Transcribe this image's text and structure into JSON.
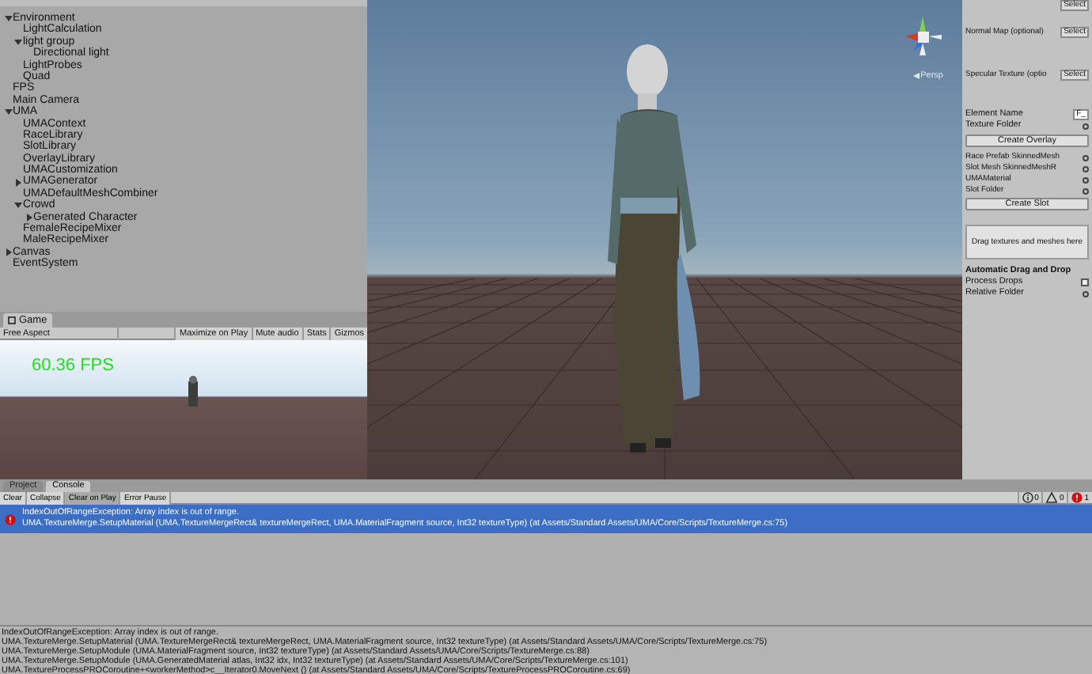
{
  "hierarchy": {
    "items": [
      {
        "label": "Environment",
        "expanded": true,
        "children": [
          {
            "label": "LightCalculation"
          },
          {
            "label": "light group",
            "expanded": true,
            "children": [
              {
                "label": "Directional light"
              }
            ]
          },
          {
            "label": "LightProbes"
          },
          {
            "label": "Quad"
          }
        ]
      },
      {
        "label": "FPS"
      },
      {
        "label": "Main Camera"
      },
      {
        "label": "UMA",
        "expanded": true,
        "children": [
          {
            "label": "UMAContext"
          },
          {
            "label": "RaceLibrary"
          },
          {
            "label": "SlotLibrary"
          },
          {
            "label": "OverlayLibrary"
          },
          {
            "label": "UMACustomization"
          },
          {
            "label": "UMAGenerator",
            "expanded": false
          },
          {
            "label": "UMADefaultMeshCombiner"
          },
          {
            "label": "Crowd",
            "expanded": true,
            "children": [
              {
                "label": "Generated Character",
                "expanded": false
              }
            ]
          },
          {
            "label": "FemaleRecipeMixer"
          },
          {
            "label": "MaleRecipeMixer"
          }
        ]
      },
      {
        "label": "Canvas",
        "expanded": false
      },
      {
        "label": "EventSystem"
      }
    ]
  },
  "game": {
    "tab": "Game",
    "aspect": "Free Aspect",
    "buttons": [
      {
        "label": "Maximize on Play",
        "selected": false
      },
      {
        "label": "Mute audio",
        "selected": false
      },
      {
        "label": "Stats",
        "selected": false
      },
      {
        "label": "Gizmos",
        "selected": false
      }
    ],
    "fps": "60.36 FPS"
  },
  "scene": {
    "persp": "Persp"
  },
  "inspector": {
    "texture_rows": [
      {
        "label": "Normal Map (optional)",
        "button": "Select"
      },
      {
        "label": "Specular Texture (optio",
        "button": "Select"
      }
    ],
    "top_button": "Select",
    "element_name": {
      "label": "Element Name",
      "value": "F_"
    },
    "texture_folder": "Texture Folder",
    "create_overlay": "Create Overlay",
    "slot_rows": [
      "Race Prefab SkinnedMesh",
      "Slot Mesh SkinnedMeshR",
      "UMAMaterial",
      "Slot Folder"
    ],
    "create_slot": "Create Slot",
    "drop_area": "Drag textures and meshes here",
    "auto_heading": "Automatic Drag and Drop",
    "process_drops": {
      "label": "Process Drops",
      "checked": false
    },
    "relative_folder": "Relative Folder"
  },
  "console": {
    "tabs": [
      {
        "label": "Project",
        "selected": false
      },
      {
        "label": "Console",
        "selected": true
      }
    ],
    "buttons": [
      {
        "label": "Clear",
        "selected": false
      },
      {
        "label": "Collapse",
        "selected": false
      },
      {
        "label": "Clear on Play",
        "selected": true
      },
      {
        "label": "Error Pause",
        "selected": false
      }
    ],
    "counts": [
      {
        "kind": "info",
        "count": "0"
      },
      {
        "kind": "warning",
        "count": "0"
      },
      {
        "kind": "error",
        "count": "1"
      }
    ],
    "entries": [
      {
        "kind": "error",
        "selected": true,
        "lines": [
          "IndexOutOfRangeException: Array index is out of range.",
          "UMA.TextureMerge.SetupMaterial (UMA.TextureMergeRect& textureMergeRect, UMA.MaterialFragment source, Int32 textureType) (at Assets/Standard Assets/UMA/Core/Scripts/TextureMerge.cs:75)"
        ]
      }
    ],
    "details": [
      "IndexOutOfRangeException: Array index is out of range.",
      "UMA.TextureMerge.SetupMaterial (UMA.TextureMergeRect& textureMergeRect, UMA.MaterialFragment source, Int32 textureType) (at Assets/Standard Assets/UMA/Core/Scripts/TextureMerge.cs:75)",
      "UMA.TextureMerge.SetupModule (UMA.MaterialFragment source, Int32 textureType) (at Assets/Standard Assets/UMA/Core/Scripts/TextureMerge.cs:88)",
      "UMA.TextureMerge.SetupModule (UMA.GeneratedMaterial atlas, Int32 idx, Int32 textureType) (at Assets/Standard Assets/UMA/Core/Scripts/TextureMerge.cs:101)",
      "UMA.TextureProcessPROCoroutine+<workerMethod>c__Iterator0.MoveNext () (at Assets/Standard Assets/UMA/Core/Scripts/TextureProcessPROCoroutine.cs:69)"
    ]
  }
}
